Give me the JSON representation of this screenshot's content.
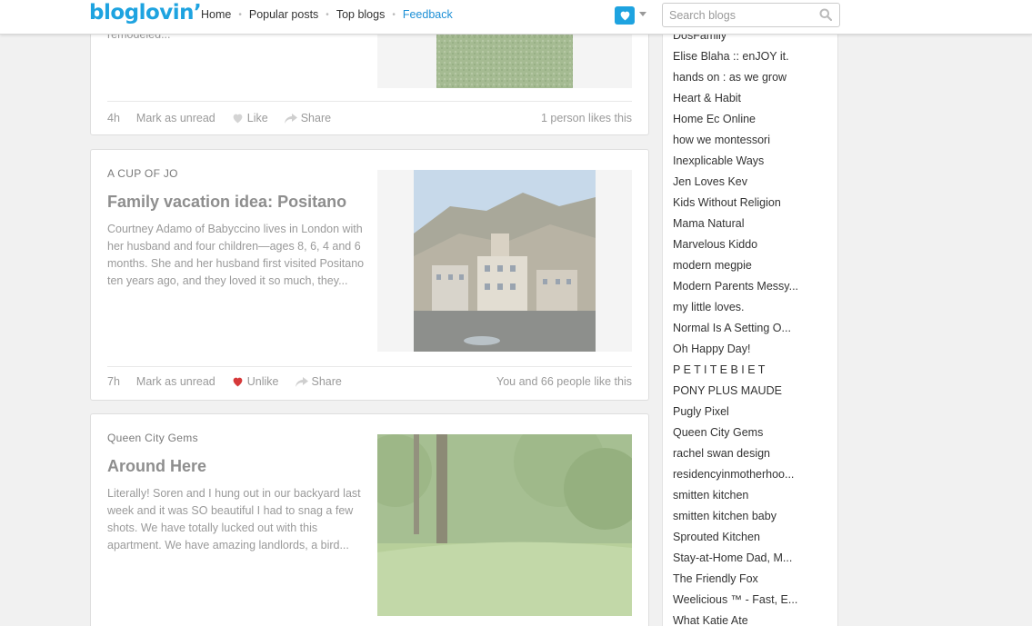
{
  "header": {
    "logo": "bloglovin’",
    "nav": [
      "Home",
      "Popular posts",
      "Top blogs",
      "Feedback"
    ],
    "search_placeholder": "Search blogs",
    "accent_color": "#1ea3e0"
  },
  "posts": [
    {
      "blog": "",
      "title": "",
      "excerpt": "remodeled...",
      "age": "4h",
      "mark_unread": "Mark as unread",
      "like_label": "Like",
      "liked": false,
      "share": "Share",
      "likes_text": "1 person likes this",
      "image": "grass-photo"
    },
    {
      "blog": "A CUP OF JO",
      "title": "Family vacation idea: Positano",
      "excerpt": "Courtney Adamo of Babyccino lives in London with her husband and four children—ages 8, 6, 4 and 6 months. She and her husband first visited Positano ten years ago, and they loved it so much, they...",
      "age": "7h",
      "mark_unread": "Mark as unread",
      "like_label": "Unlike",
      "liked": true,
      "share": "Share",
      "likes_text": "You and 66 people like this",
      "image": "positano-photo"
    },
    {
      "blog": "Queen City Gems",
      "title": "Around Here",
      "excerpt": "Literally! Soren and I hung out in our backyard last week and it was SO beautiful I had to snag a few shots. We have totally lucked out with this apartment. We have amazing landlords, a bird...",
      "image": "backyard-photo"
    }
  ],
  "sidebar": {
    "blogs": [
      "DosFamily",
      "Elise Blaha :: enJOY it.",
      "hands on : as we grow",
      "Heart & Habit",
      "Home Ec Online",
      "how we montessori",
      "Inexplicable Ways",
      "Jen Loves Kev",
      "Kids Without Religion",
      "Mama Natural",
      "Marvelous Kiddo",
      "modern megpie",
      "Modern Parents Messy...",
      "my little loves.",
      "Normal Is A Setting O...",
      "Oh Happy Day!",
      "P E T I T E B I E T",
      "PONY PLUS MAUDE",
      "Pugly Pixel",
      "Queen City Gems",
      "rachel swan design",
      "residencyinmotherhoo...",
      "smitten kitchen",
      "smitten kitchen baby",
      "Sprouted Kitchen",
      "Stay-at-Home Dad, M...",
      "The Friendly Fox",
      "Weelicious ™ - Fast, E...",
      "What Katie Ate"
    ]
  }
}
